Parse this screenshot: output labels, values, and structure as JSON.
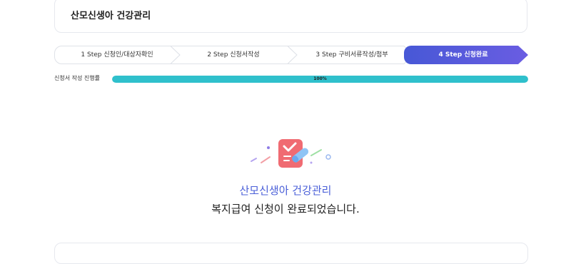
{
  "header": {
    "title": "산모신생아 건강관리"
  },
  "steps": [
    {
      "label": "1 Step 신청인/대상자확인",
      "active": false
    },
    {
      "label": "2 Step 신청서작성",
      "active": false
    },
    {
      "label": "3 Step 구비서류작성/첨부",
      "active": false
    },
    {
      "label": "4 Step 신청완료",
      "active": true
    }
  ],
  "progress": {
    "label": "신청서 작성 진행률",
    "value": 100,
    "text": "100%"
  },
  "completion": {
    "title": "산모신생아 건강관리",
    "message": "복지급여 신청이 완료되었습니다."
  },
  "colors": {
    "accent": "#4a5fd8",
    "progress": "#2fc0cc",
    "active_step_start": "#4758d6",
    "active_step_end": "#6a5de2"
  },
  "icons": {
    "completion": "document-check-pencil-icon"
  }
}
